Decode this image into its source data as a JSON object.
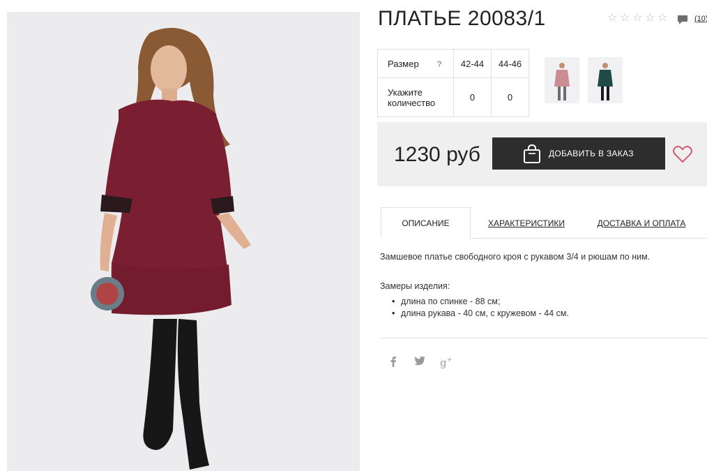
{
  "product": {
    "title": "ПЛАТЬЕ 20083/1",
    "rating_stars": 0,
    "reviews_count": "(10)",
    "image_alt": "product-photo"
  },
  "size_table": {
    "size_label": "Размер",
    "help": "?",
    "sizes": [
      "42-44",
      "44-46"
    ],
    "qty_label": "Укажите количество",
    "quantities": [
      "0",
      "0"
    ]
  },
  "colors": [
    {
      "name": "pink",
      "swatch": "#c98d93"
    },
    {
      "name": "green",
      "swatch": "#1f4a45"
    }
  ],
  "purchase": {
    "price": "1230 руб",
    "add_label": "ДОБАВИТЬ В ЗАКАЗ"
  },
  "tabs": [
    {
      "label": "ОПИСАНИЕ",
      "active": true
    },
    {
      "label": "ХАРАКТЕРИСТИКИ",
      "active": false
    },
    {
      "label": "ДОСТАВКА И ОПЛАТА",
      "active": false
    }
  ],
  "description": {
    "text": "Замшевое платье свободного кроя с рукавом 3/4 и рюшам по ним.",
    "measures_title": "Замеры изделия:",
    "measures": [
      "длина по спинке - 88 см;",
      "длина рукава - 40 см, с кружевом - 44 см."
    ]
  },
  "social": [
    "facebook-icon",
    "twitter-icon",
    "google-plus-icon"
  ],
  "colors_theme": {
    "accent_dark": "#2d2d2d",
    "heart": "#d05a75",
    "dress": "#7a1f32"
  }
}
